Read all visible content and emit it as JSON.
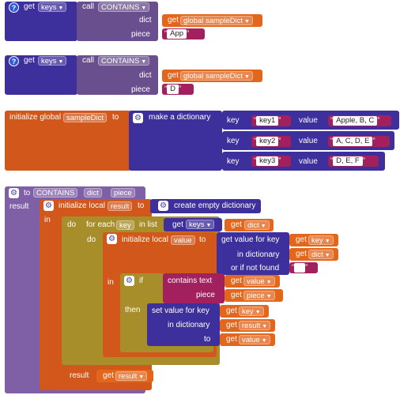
{
  "colors": {
    "dictionary_block": "#3d2f9c",
    "procedure_block": "#6a4f8f",
    "variable_block": "#e3661d",
    "control_block": "#a88e2a",
    "text_block": "#a3205e"
  },
  "icons": {
    "help": "?",
    "mutator": "⚙"
  },
  "block1": {
    "get_label": "get",
    "get_dropdown": "keys",
    "call_label": "call",
    "call_dropdown": "CONTAINS",
    "dict_label": "dict",
    "dict_get": "get",
    "dict_var": "global sampleDict",
    "piece_label": "piece",
    "piece_value": "App"
  },
  "block2": {
    "get_label": "get",
    "get_dropdown": "keys",
    "call_label": "call",
    "call_dropdown": "CONTAINS",
    "dict_label": "dict",
    "dict_get": "get",
    "dict_var": "global sampleDict",
    "piece_label": "piece",
    "piece_value": "D"
  },
  "init_global": {
    "label": "initialize global",
    "name": "sampleDict",
    "to": "to",
    "make_dict": "make a dictionary",
    "pairs": [
      {
        "key_label": "key",
        "key": "key1",
        "value_label": "value",
        "value": "Apple, B, C"
      },
      {
        "key_label": "key",
        "key": "key2",
        "value_label": "value",
        "value": "A, C, D, E"
      },
      {
        "key_label": "key",
        "key": "key3",
        "value_label": "value",
        "value": "D, E, F"
      }
    ]
  },
  "procedure": {
    "to": "to",
    "name": "CONTAINS",
    "param1": "dict",
    "param2": "piece",
    "result": "result",
    "init_local": "initialize local",
    "local_name": "result",
    "to_label": "to",
    "create_empty": "create empty dictionary",
    "in_label": "in",
    "do_label": "do",
    "for_each": "for each",
    "loop_var": "key",
    "in_list": "in list",
    "get": "get",
    "keys_dropdown": "keys",
    "get_dict": "dict",
    "do2": "do",
    "init_local2": "initialize local",
    "local_name2": "value",
    "to2": "to",
    "get_value_for_key": "get value for key",
    "key_var": "key",
    "in_dictionary": "in dictionary",
    "dict_var": "dict",
    "or_if_not_found": "or if not found",
    "in2": "in",
    "if_label": "if",
    "contains_text": "contains  text",
    "value_var": "value",
    "piece_label": "piece",
    "piece_var": "piece",
    "then_label": "then",
    "set_value_for_key": "set value for key",
    "key_var2": "key",
    "in_dictionary2": "in dictionary",
    "result_var": "result",
    "to3": "to",
    "value_var2": "value",
    "result_label2": "result",
    "result_var2": "result"
  }
}
